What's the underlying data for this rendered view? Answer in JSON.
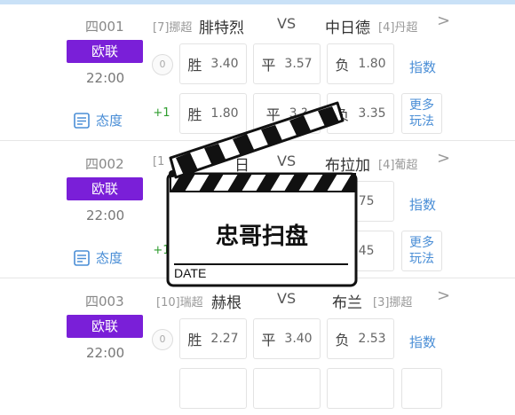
{
  "matches": [
    {
      "num": "四001",
      "league": "欧联",
      "time": "22:00",
      "home_rank": "[7]挪超",
      "home": "腓特烈",
      "vs": "VS",
      "away": "中日德",
      "away_rank": "[4]丹超",
      "row1": {
        "handicap": "0",
        "win_k": "胜",
        "win": "3.40",
        "draw_k": "平",
        "draw": "3.57",
        "lose_k": "负",
        "lose": "1.80",
        "extra": "指数"
      },
      "row2": {
        "handicap": "+1",
        "win_k": "胜",
        "win": "1.80",
        "draw_k": "平",
        "draw": "3.?",
        "lose_k": "负",
        "lose": "3.35",
        "extra": "更多玩法"
      },
      "attitude": "态度"
    },
    {
      "num": "四002",
      "league": "欧联",
      "time": "22:00",
      "home_rank": "[1",
      "home": "日",
      "vs": "VS",
      "away": "布拉加",
      "away_rank": "[4]葡超",
      "row1": {
        "lose": "1.75",
        "extra": "指数"
      },
      "row2": {
        "handicap": "+1",
        "lose": "3.45",
        "extra": "更多玩法"
      },
      "attitude": "态度"
    },
    {
      "num": "四003",
      "league": "欧联",
      "time": "22:00",
      "home_rank": "[10]瑞超",
      "home": "赫根",
      "vs": "VS",
      "away": "布兰",
      "away_rank": "[3]挪超",
      "row1": {
        "handicap": "0",
        "win_k": "胜",
        "win": "2.27",
        "draw_k": "平",
        "draw": "3.40",
        "lose_k": "负",
        "lose": "2.53",
        "extra": "指数"
      }
    }
  ],
  "overlay": {
    "title": "忠哥扫盘",
    "date_label": "DATE"
  },
  "colors": {
    "accent": "#7a1fd8",
    "link": "#4a8ed6"
  }
}
